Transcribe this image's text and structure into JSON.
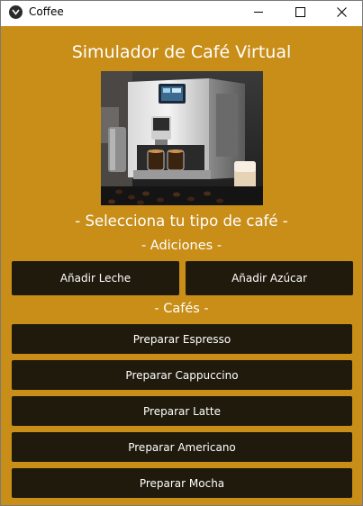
{
  "window": {
    "title": "Coffee"
  },
  "app": {
    "heading": "Simulador de Café Virtual",
    "image_alt": "Coffee machine photo",
    "subheading": "- Selecciona tu tipo de café -"
  },
  "additions": {
    "label": "- Adiciones -",
    "buttons": [
      {
        "label": "Añadir Leche"
      },
      {
        "label": "Añadir Azúcar"
      }
    ]
  },
  "coffees": {
    "label": "- Cafés -",
    "buttons": [
      {
        "label": "Preparar Espresso"
      },
      {
        "label": "Preparar Cappuccino"
      },
      {
        "label": "Preparar Latte"
      },
      {
        "label": "Preparar Americano"
      },
      {
        "label": "Preparar Mocha"
      }
    ]
  },
  "colors": {
    "background": "#c98e18",
    "button": "#201a0d",
    "text": "#ffffff"
  },
  "icons": [
    "app-icon",
    "minimize-icon",
    "maximize-icon",
    "close-icon"
  ]
}
